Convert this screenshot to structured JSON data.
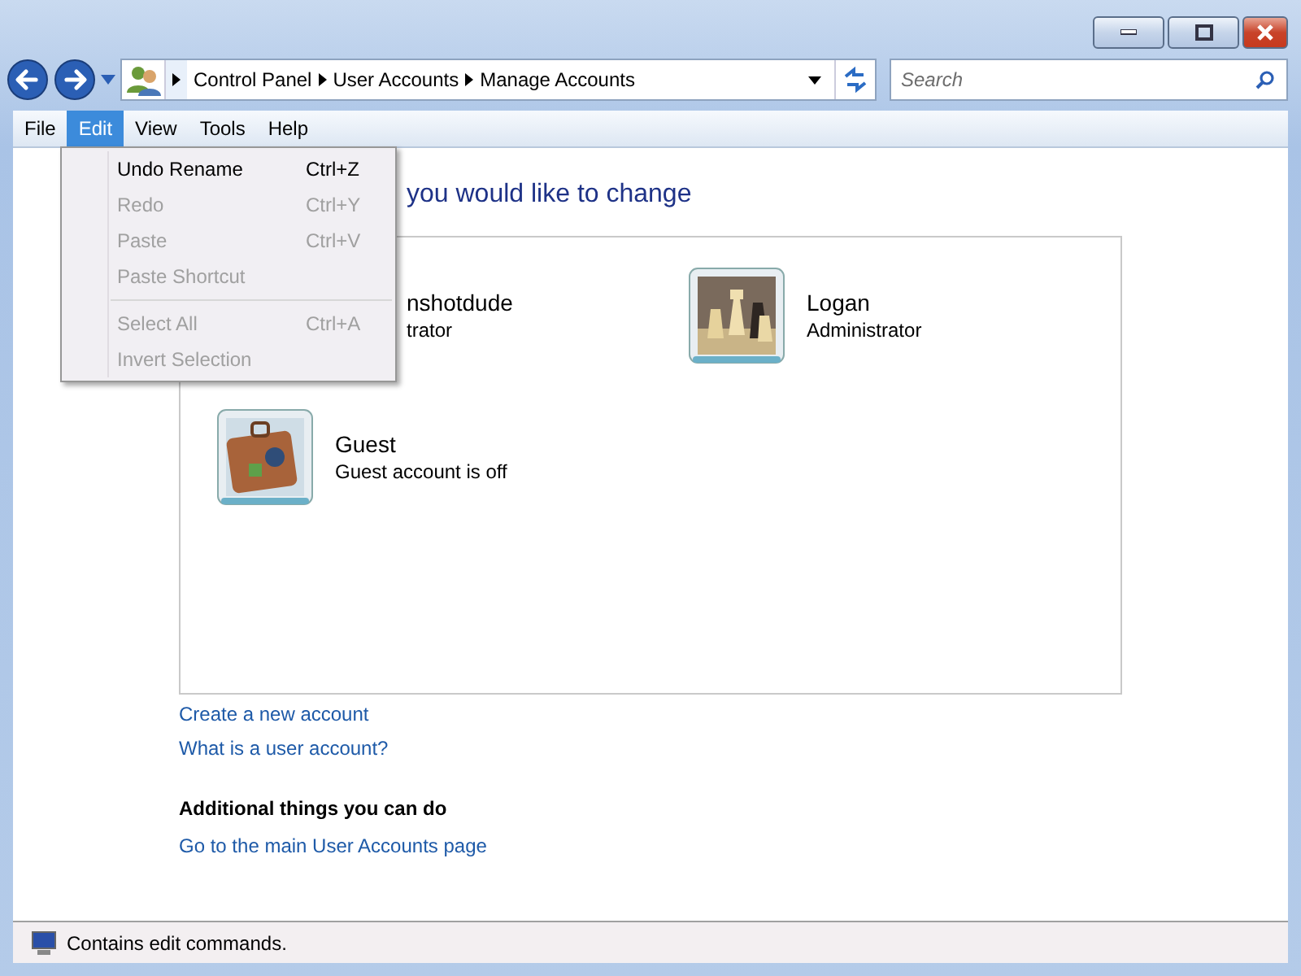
{
  "address_bar": {
    "breadcrumbs": [
      "Control Panel",
      "User Accounts",
      "Manage Accounts"
    ]
  },
  "search": {
    "placeholder": "Search"
  },
  "menu_bar": [
    {
      "label": "File",
      "selected": false
    },
    {
      "label": "Edit",
      "selected": true
    },
    {
      "label": "View",
      "selected": false
    },
    {
      "label": "Tools",
      "selected": false
    },
    {
      "label": "Help",
      "selected": false
    }
  ],
  "edit_menu": [
    {
      "kind": "item",
      "label": "Undo Rename",
      "shortcut": "Ctrl+Z",
      "disabled": false
    },
    {
      "kind": "item",
      "label": "Redo",
      "shortcut": "Ctrl+Y",
      "disabled": true
    },
    {
      "kind": "item",
      "label": "Paste",
      "shortcut": "Ctrl+V",
      "disabled": true
    },
    {
      "kind": "item",
      "label": "Paste Shortcut",
      "disabled": true
    },
    {
      "kind": "separator"
    },
    {
      "kind": "item",
      "label": "Select All",
      "shortcut": "Ctrl+A",
      "disabled": true
    },
    {
      "kind": "item",
      "label": "Invert Selection",
      "disabled": true
    }
  ],
  "heading": "you would like to change",
  "accounts": [
    {
      "kind": "covered",
      "name": "nshotdude",
      "detail": "trator"
    },
    {
      "kind": "chess",
      "name": "Logan",
      "detail": "Administrator"
    },
    {
      "kind": "suitcase",
      "name": "Guest",
      "detail": "Guest account is off"
    }
  ],
  "links": [
    "Create a new account",
    "What is a user account?"
  ],
  "additional": {
    "title": "Additional things you can do",
    "links": [
      "Go to the main User Accounts page"
    ]
  },
  "status_bar": {
    "text": "Contains edit commands."
  }
}
